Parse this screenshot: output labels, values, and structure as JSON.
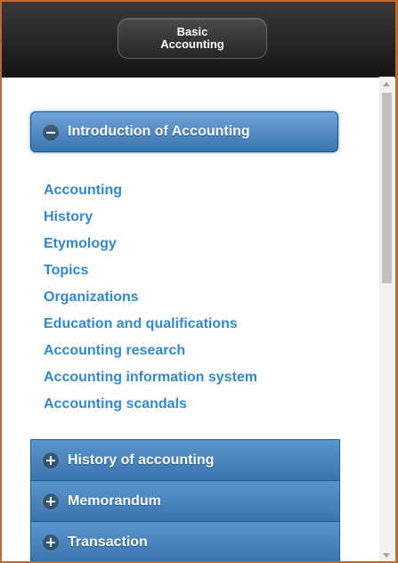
{
  "header": {
    "title": "Basic Accounting"
  },
  "open_section": {
    "label": "Introduction of Accounting",
    "icon": "minus-icon",
    "links": [
      "Accounting",
      "History",
      "Etymology",
      "Topics",
      "Organizations",
      "Education and qualifications",
      "Accounting research",
      "Accounting information system",
      "Accounting scandals"
    ]
  },
  "collapsed_sections": [
    {
      "label": "History of accounting",
      "icon": "plus-icon"
    },
    {
      "label": "Memorandum",
      "icon": "plus-icon"
    },
    {
      "label": "Transaction",
      "icon": "plus-icon"
    }
  ],
  "colors": {
    "accent": "#3a75b0",
    "link": "#3388cc",
    "header": "#1f1f1f",
    "frame": "#c0692a"
  }
}
